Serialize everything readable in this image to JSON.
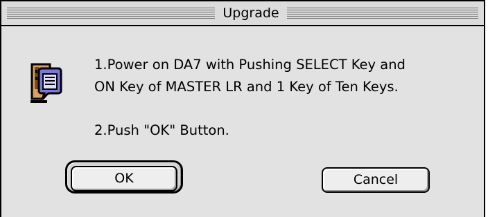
{
  "window": {
    "title": "Upgrade"
  },
  "dialog": {
    "icon": "note-alert-icon",
    "message_line1": "1.Power on DA7 with Pushing SELECT Key and",
    "message_line2": "ON Key of MASTER LR and 1 Key of Ten Keys.",
    "message_line3": "2.Push \"OK\" Button."
  },
  "buttons": {
    "ok_label": "OK",
    "cancel_label": "Cancel",
    "default": "OK"
  },
  "colors": {
    "background": "#e2e2e2",
    "border": "#000000",
    "icon_accent": "#7a78e0",
    "icon_body": "#d9a15c"
  }
}
